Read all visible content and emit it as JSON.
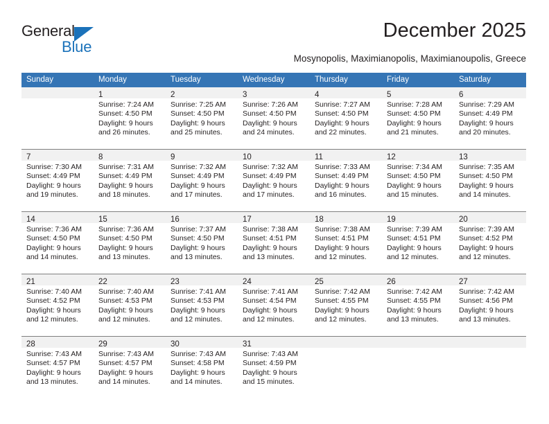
{
  "brand": {
    "name_part1": "General",
    "name_part2": "Blue",
    "accent_color": "#1b72ba"
  },
  "header": {
    "title": "December 2025",
    "subtitle": "Mosynopolis, Maximianopolis, Maximianoupolis, Greece"
  },
  "calendar": {
    "header_color": "#3575b5",
    "weekdays": [
      "Sunday",
      "Monday",
      "Tuesday",
      "Wednesday",
      "Thursday",
      "Friday",
      "Saturday"
    ],
    "weeks": [
      [
        {
          "day": "",
          "sunrise": "",
          "sunset": "",
          "daylight1": "",
          "daylight2": ""
        },
        {
          "day": "1",
          "sunrise": "Sunrise: 7:24 AM",
          "sunset": "Sunset: 4:50 PM",
          "daylight1": "Daylight: 9 hours",
          "daylight2": "and 26 minutes."
        },
        {
          "day": "2",
          "sunrise": "Sunrise: 7:25 AM",
          "sunset": "Sunset: 4:50 PM",
          "daylight1": "Daylight: 9 hours",
          "daylight2": "and 25 minutes."
        },
        {
          "day": "3",
          "sunrise": "Sunrise: 7:26 AM",
          "sunset": "Sunset: 4:50 PM",
          "daylight1": "Daylight: 9 hours",
          "daylight2": "and 24 minutes."
        },
        {
          "day": "4",
          "sunrise": "Sunrise: 7:27 AM",
          "sunset": "Sunset: 4:50 PM",
          "daylight1": "Daylight: 9 hours",
          "daylight2": "and 22 minutes."
        },
        {
          "day": "5",
          "sunrise": "Sunrise: 7:28 AM",
          "sunset": "Sunset: 4:50 PM",
          "daylight1": "Daylight: 9 hours",
          "daylight2": "and 21 minutes."
        },
        {
          "day": "6",
          "sunrise": "Sunrise: 7:29 AM",
          "sunset": "Sunset: 4:49 PM",
          "daylight1": "Daylight: 9 hours",
          "daylight2": "and 20 minutes."
        }
      ],
      [
        {
          "day": "7",
          "sunrise": "Sunrise: 7:30 AM",
          "sunset": "Sunset: 4:49 PM",
          "daylight1": "Daylight: 9 hours",
          "daylight2": "and 19 minutes."
        },
        {
          "day": "8",
          "sunrise": "Sunrise: 7:31 AM",
          "sunset": "Sunset: 4:49 PM",
          "daylight1": "Daylight: 9 hours",
          "daylight2": "and 18 minutes."
        },
        {
          "day": "9",
          "sunrise": "Sunrise: 7:32 AM",
          "sunset": "Sunset: 4:49 PM",
          "daylight1": "Daylight: 9 hours",
          "daylight2": "and 17 minutes."
        },
        {
          "day": "10",
          "sunrise": "Sunrise: 7:32 AM",
          "sunset": "Sunset: 4:49 PM",
          "daylight1": "Daylight: 9 hours",
          "daylight2": "and 17 minutes."
        },
        {
          "day": "11",
          "sunrise": "Sunrise: 7:33 AM",
          "sunset": "Sunset: 4:49 PM",
          "daylight1": "Daylight: 9 hours",
          "daylight2": "and 16 minutes."
        },
        {
          "day": "12",
          "sunrise": "Sunrise: 7:34 AM",
          "sunset": "Sunset: 4:50 PM",
          "daylight1": "Daylight: 9 hours",
          "daylight2": "and 15 minutes."
        },
        {
          "day": "13",
          "sunrise": "Sunrise: 7:35 AM",
          "sunset": "Sunset: 4:50 PM",
          "daylight1": "Daylight: 9 hours",
          "daylight2": "and 14 minutes."
        }
      ],
      [
        {
          "day": "14",
          "sunrise": "Sunrise: 7:36 AM",
          "sunset": "Sunset: 4:50 PM",
          "daylight1": "Daylight: 9 hours",
          "daylight2": "and 14 minutes."
        },
        {
          "day": "15",
          "sunrise": "Sunrise: 7:36 AM",
          "sunset": "Sunset: 4:50 PM",
          "daylight1": "Daylight: 9 hours",
          "daylight2": "and 13 minutes."
        },
        {
          "day": "16",
          "sunrise": "Sunrise: 7:37 AM",
          "sunset": "Sunset: 4:50 PM",
          "daylight1": "Daylight: 9 hours",
          "daylight2": "and 13 minutes."
        },
        {
          "day": "17",
          "sunrise": "Sunrise: 7:38 AM",
          "sunset": "Sunset: 4:51 PM",
          "daylight1": "Daylight: 9 hours",
          "daylight2": "and 13 minutes."
        },
        {
          "day": "18",
          "sunrise": "Sunrise: 7:38 AM",
          "sunset": "Sunset: 4:51 PM",
          "daylight1": "Daylight: 9 hours",
          "daylight2": "and 12 minutes."
        },
        {
          "day": "19",
          "sunrise": "Sunrise: 7:39 AM",
          "sunset": "Sunset: 4:51 PM",
          "daylight1": "Daylight: 9 hours",
          "daylight2": "and 12 minutes."
        },
        {
          "day": "20",
          "sunrise": "Sunrise: 7:39 AM",
          "sunset": "Sunset: 4:52 PM",
          "daylight1": "Daylight: 9 hours",
          "daylight2": "and 12 minutes."
        }
      ],
      [
        {
          "day": "21",
          "sunrise": "Sunrise: 7:40 AM",
          "sunset": "Sunset: 4:52 PM",
          "daylight1": "Daylight: 9 hours",
          "daylight2": "and 12 minutes."
        },
        {
          "day": "22",
          "sunrise": "Sunrise: 7:40 AM",
          "sunset": "Sunset: 4:53 PM",
          "daylight1": "Daylight: 9 hours",
          "daylight2": "and 12 minutes."
        },
        {
          "day": "23",
          "sunrise": "Sunrise: 7:41 AM",
          "sunset": "Sunset: 4:53 PM",
          "daylight1": "Daylight: 9 hours",
          "daylight2": "and 12 minutes."
        },
        {
          "day": "24",
          "sunrise": "Sunrise: 7:41 AM",
          "sunset": "Sunset: 4:54 PM",
          "daylight1": "Daylight: 9 hours",
          "daylight2": "and 12 minutes."
        },
        {
          "day": "25",
          "sunrise": "Sunrise: 7:42 AM",
          "sunset": "Sunset: 4:55 PM",
          "daylight1": "Daylight: 9 hours",
          "daylight2": "and 12 minutes."
        },
        {
          "day": "26",
          "sunrise": "Sunrise: 7:42 AM",
          "sunset": "Sunset: 4:55 PM",
          "daylight1": "Daylight: 9 hours",
          "daylight2": "and 13 minutes."
        },
        {
          "day": "27",
          "sunrise": "Sunrise: 7:42 AM",
          "sunset": "Sunset: 4:56 PM",
          "daylight1": "Daylight: 9 hours",
          "daylight2": "and 13 minutes."
        }
      ],
      [
        {
          "day": "28",
          "sunrise": "Sunrise: 7:43 AM",
          "sunset": "Sunset: 4:57 PM",
          "daylight1": "Daylight: 9 hours",
          "daylight2": "and 13 minutes."
        },
        {
          "day": "29",
          "sunrise": "Sunrise: 7:43 AM",
          "sunset": "Sunset: 4:57 PM",
          "daylight1": "Daylight: 9 hours",
          "daylight2": "and 14 minutes."
        },
        {
          "day": "30",
          "sunrise": "Sunrise: 7:43 AM",
          "sunset": "Sunset: 4:58 PM",
          "daylight1": "Daylight: 9 hours",
          "daylight2": "and 14 minutes."
        },
        {
          "day": "31",
          "sunrise": "Sunrise: 7:43 AM",
          "sunset": "Sunset: 4:59 PM",
          "daylight1": "Daylight: 9 hours",
          "daylight2": "and 15 minutes."
        },
        {
          "day": "",
          "sunrise": "",
          "sunset": "",
          "daylight1": "",
          "daylight2": ""
        },
        {
          "day": "",
          "sunrise": "",
          "sunset": "",
          "daylight1": "",
          "daylight2": ""
        },
        {
          "day": "",
          "sunrise": "",
          "sunset": "",
          "daylight1": "",
          "daylight2": ""
        }
      ]
    ]
  }
}
